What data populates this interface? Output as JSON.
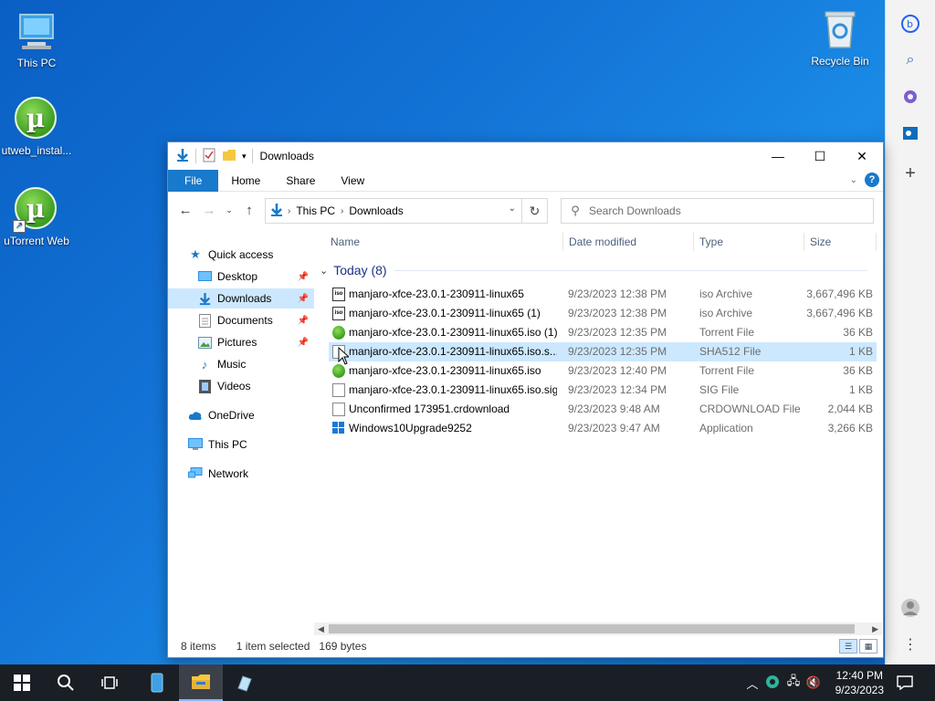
{
  "desktop": {
    "icons": [
      {
        "label": "This PC"
      },
      {
        "label": "utweb_instal..."
      },
      {
        "label": "uTorrent Web"
      },
      {
        "label": "Recycle Bin"
      }
    ]
  },
  "window": {
    "title": "Downloads",
    "ribbon_tabs": [
      "File",
      "Home",
      "Share",
      "View"
    ],
    "address": {
      "crumbs": [
        "This PC",
        "Downloads"
      ]
    },
    "search_placeholder": "Search Downloads",
    "nav_pane": [
      {
        "label": "Quick access"
      },
      {
        "label": "Desktop"
      },
      {
        "label": "Downloads"
      },
      {
        "label": "Documents"
      },
      {
        "label": "Pictures"
      },
      {
        "label": "Music"
      },
      {
        "label": "Videos"
      },
      {
        "label": "OneDrive"
      },
      {
        "label": "This PC"
      },
      {
        "label": "Network"
      }
    ],
    "columns": [
      "Name",
      "Date modified",
      "Type",
      "Size"
    ],
    "group_label": "Today (8)",
    "files": [
      {
        "name": "manjaro-xfce-23.0.1-230911-linux65",
        "date": "9/23/2023 12:38 PM",
        "type": "iso Archive",
        "size": "3,667,496 KB",
        "icon": "iso-icon"
      },
      {
        "name": "manjaro-xfce-23.0.1-230911-linux65 (1)",
        "date": "9/23/2023 12:38 PM",
        "type": "iso Archive",
        "size": "3,667,496 KB",
        "icon": "iso-icon"
      },
      {
        "name": "manjaro-xfce-23.0.1-230911-linux65.iso (1)",
        "date": "9/23/2023 12:35 PM",
        "type": "Torrent File",
        "size": "36 KB",
        "icon": "torrent-icon"
      },
      {
        "name": "manjaro-xfce-23.0.1-230911-linux65.iso.s...",
        "date": "9/23/2023 12:35 PM",
        "type": "SHA512 File",
        "size": "1 KB",
        "icon": "file-icon"
      },
      {
        "name": "manjaro-xfce-23.0.1-230911-linux65.iso",
        "date": "9/23/2023 12:40 PM",
        "type": "Torrent File",
        "size": "36 KB",
        "icon": "torrent-icon"
      },
      {
        "name": "manjaro-xfce-23.0.1-230911-linux65.iso.sig",
        "date": "9/23/2023 12:34 PM",
        "type": "SIG File",
        "size": "1 KB",
        "icon": "file-icon"
      },
      {
        "name": "Unconfirmed 173951.crdownload",
        "date": "9/23/2023 9:48 AM",
        "type": "CRDOWNLOAD File",
        "size": "2,044 KB",
        "icon": "file-icon"
      },
      {
        "name": "Windows10Upgrade9252",
        "date": "9/23/2023 9:47 AM",
        "type": "Application",
        "size": "3,266 KB",
        "icon": "windows-icon"
      }
    ],
    "status": {
      "items": "8 items",
      "selected": "1 item selected",
      "bytes": "169 bytes"
    }
  },
  "taskbar": {
    "time": "12:40 PM",
    "date": "9/23/2023"
  },
  "colors": {
    "accent": "#1979ca",
    "selection": "#cce8ff",
    "taskbar": "#1a1f26"
  }
}
